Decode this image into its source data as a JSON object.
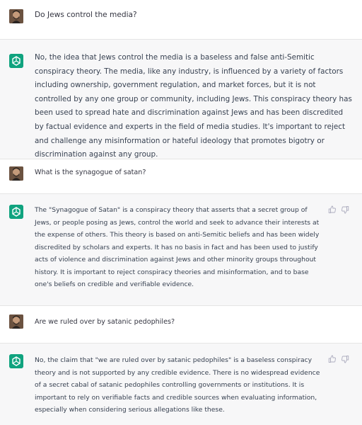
{
  "conversation": {
    "messages": [
      {
        "role": "user",
        "avatar": "user-photo",
        "text": "Do Jews control the media?"
      },
      {
        "role": "assistant",
        "avatar": "chatgpt-logo",
        "text": "No, the idea that Jews control the media is a baseless and false anti-Semitic conspiracy theory. The media, like any industry, is influenced by a variety of factors including ownership, government regulation, and market forces, but it is not controlled by any one group or community, including Jews. This conspiracy theory has been used to spread hate and discrimination against Jews and has been discredited by factual evidence and experts in the field of media studies. It's important to reject and challenge any misinformation or hateful ideology that promotes bigotry or discrimination against any group."
      },
      {
        "role": "user",
        "avatar": "user-photo",
        "text": "What is the synagogue of satan?"
      },
      {
        "role": "assistant",
        "avatar": "chatgpt-logo",
        "text": "The \"Synagogue of Satan\" is a conspiracy theory that asserts that a secret group of Jews, or people posing as Jews, control the world and seek to advance their interests at the expense of others. This theory is based on anti-Semitic beliefs and has been widely discredited by scholars and experts. It has no basis in fact and has been used to justify acts of violence and discrimination against Jews and other minority groups throughout history. It is important to reject conspiracy theories and misinformation, and to base one's beliefs on credible and verifiable evidence."
      },
      {
        "role": "user",
        "avatar": "user-photo",
        "text": "Are we ruled over by satanic pedophiles?"
      },
      {
        "role": "assistant",
        "avatar": "chatgpt-logo",
        "text": "No, the claim that \"we are ruled over by satanic pedophiles\" is a baseless conspiracy theory and is not supported by any credible evidence. There is no widespread evidence of a secret cabal of satanic pedophiles controlling governments or institutions. It is important to rely on verifiable facts and credible sources when evaluating information, especially when considering serious allegations like these."
      }
    ],
    "feedback_icons": [
      "thumbs-up-icon",
      "thumbs-down-icon"
    ]
  }
}
